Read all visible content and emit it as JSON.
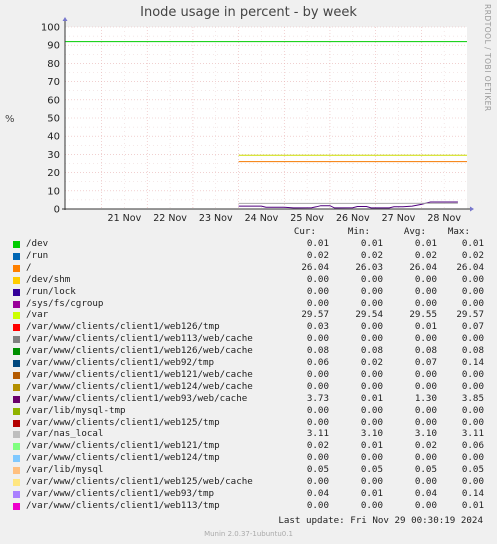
{
  "title": "Inode usage in percent - by week",
  "side_text": "RRDTOOL / TOBI OETIKER",
  "chart_data": {
    "type": "line",
    "ylabel": "%",
    "ylim": [
      0,
      100
    ],
    "y_ticks": [
      0,
      10,
      20,
      30,
      40,
      50,
      60,
      70,
      80,
      90,
      100
    ],
    "x_ticks": [
      "21 Nov",
      "22 Nov",
      "23 Nov",
      "24 Nov",
      "25 Nov",
      "26 Nov",
      "27 Nov",
      "28 Nov"
    ],
    "x_range_days": [
      20.2,
      29.0
    ],
    "series": [
      {
        "name": "/dev",
        "color": "#00cc00",
        "points": [
          [
            20.2,
            92
          ],
          [
            29.0,
            92
          ]
        ]
      },
      {
        "name": "/",
        "color": "#f57900",
        "points": [
          [
            24.0,
            26.04
          ],
          [
            29.0,
            26.04
          ]
        ]
      },
      {
        "name": "/var",
        "color": "#ccdd00",
        "points": [
          [
            24.0,
            29.55
          ],
          [
            29.0,
            29.55
          ]
        ]
      },
      {
        "name": "/var/www/clients/client1/web93/web/cache",
        "color": "#4f007f",
        "points": [
          [
            24.0,
            1.6
          ],
          [
            24.5,
            1.6
          ],
          [
            24.6,
            1.0
          ],
          [
            25.0,
            1.0
          ],
          [
            25.2,
            0.6
          ],
          [
            25.6,
            0.7
          ],
          [
            25.7,
            1.2
          ],
          [
            25.8,
            1.8
          ],
          [
            26.0,
            1.8
          ],
          [
            26.1,
            0.6
          ],
          [
            26.5,
            0.7
          ],
          [
            26.6,
            1.4
          ],
          [
            26.8,
            1.4
          ],
          [
            26.9,
            0.6
          ],
          [
            27.3,
            0.6
          ],
          [
            27.4,
            1.2
          ],
          [
            27.6,
            1.2
          ],
          [
            27.8,
            1.6
          ],
          [
            28.0,
            2.5
          ],
          [
            28.2,
            3.85
          ],
          [
            28.8,
            3.85
          ]
        ]
      },
      {
        "name": "/var/nas_local",
        "color": "#aaaaaa",
        "points": [
          [
            24.0,
            3.1
          ],
          [
            28.8,
            3.11
          ]
        ]
      }
    ]
  },
  "legend_header": {
    "cur": "Cur:",
    "min": "Min:",
    "avg": "Avg:",
    "max": "Max:"
  },
  "legend": [
    {
      "color": "#00cc00",
      "name": "/dev",
      "cur": "0.01",
      "min": "0.01",
      "avg": "0.01",
      "max": "0.01"
    },
    {
      "color": "#0066b3",
      "name": "/run",
      "cur": "0.02",
      "min": "0.02",
      "avg": "0.02",
      "max": "0.02"
    },
    {
      "color": "#ff8000",
      "name": "/",
      "cur": "26.04",
      "min": "26.03",
      "avg": "26.04",
      "max": "26.04"
    },
    {
      "color": "#ffcc00",
      "name": "/dev/shm",
      "cur": "0.00",
      "min": "0.00",
      "avg": "0.00",
      "max": "0.00"
    },
    {
      "color": "#330099",
      "name": "/run/lock",
      "cur": "0.00",
      "min": "0.00",
      "avg": "0.00",
      "max": "0.00"
    },
    {
      "color": "#990099",
      "name": "/sys/fs/cgroup",
      "cur": "0.00",
      "min": "0.00",
      "avg": "0.00",
      "max": "0.00"
    },
    {
      "color": "#ccff00",
      "name": "/var",
      "cur": "29.57",
      "min": "29.54",
      "avg": "29.55",
      "max": "29.57"
    },
    {
      "color": "#ff0000",
      "name": "/var/www/clients/client1/web126/tmp",
      "cur": "0.03",
      "min": "0.00",
      "avg": "0.01",
      "max": "0.07"
    },
    {
      "color": "#808080",
      "name": "/var/www/clients/client1/web113/web/cache",
      "cur": "0.00",
      "min": "0.00",
      "avg": "0.00",
      "max": "0.00"
    },
    {
      "color": "#008f00",
      "name": "/var/www/clients/client1/web126/web/cache",
      "cur": "0.08",
      "min": "0.08",
      "avg": "0.08",
      "max": "0.08"
    },
    {
      "color": "#00487d",
      "name": "/var/www/clients/client1/web92/tmp",
      "cur": "0.06",
      "min": "0.02",
      "avg": "0.07",
      "max": "0.14"
    },
    {
      "color": "#b35a00",
      "name": "/var/www/clients/client1/web121/web/cache",
      "cur": "0.00",
      "min": "0.00",
      "avg": "0.00",
      "max": "0.00"
    },
    {
      "color": "#b38f00",
      "name": "/var/www/clients/client1/web124/web/cache",
      "cur": "0.00",
      "min": "0.00",
      "avg": "0.00",
      "max": "0.00"
    },
    {
      "color": "#6b006b",
      "name": "/var/www/clients/client1/web93/web/cache",
      "cur": "3.73",
      "min": "0.01",
      "avg": "1.30",
      "max": "3.85"
    },
    {
      "color": "#8fb300",
      "name": "/var/lib/mysql-tmp",
      "cur": "0.00",
      "min": "0.00",
      "avg": "0.00",
      "max": "0.00"
    },
    {
      "color": "#b30000",
      "name": "/var/www/clients/client1/web125/tmp",
      "cur": "0.00",
      "min": "0.00",
      "avg": "0.00",
      "max": "0.00"
    },
    {
      "color": "#bebebe",
      "name": "/var/nas_local",
      "cur": "3.11",
      "min": "3.10",
      "avg": "3.10",
      "max": "3.11"
    },
    {
      "color": "#80ff80",
      "name": "/var/www/clients/client1/web121/tmp",
      "cur": "0.02",
      "min": "0.01",
      "avg": "0.02",
      "max": "0.06"
    },
    {
      "color": "#80c9ff",
      "name": "/var/www/clients/client1/web124/tmp",
      "cur": "0.00",
      "min": "0.00",
      "avg": "0.00",
      "max": "0.00"
    },
    {
      "color": "#ffc080",
      "name": "/var/lib/mysql",
      "cur": "0.05",
      "min": "0.05",
      "avg": "0.05",
      "max": "0.05"
    },
    {
      "color": "#ffe680",
      "name": "/var/www/clients/client1/web125/web/cache",
      "cur": "0.00",
      "min": "0.00",
      "avg": "0.00",
      "max": "0.00"
    },
    {
      "color": "#aa80ff",
      "name": "/var/www/clients/client1/web93/tmp",
      "cur": "0.04",
      "min": "0.01",
      "avg": "0.04",
      "max": "0.14"
    },
    {
      "color": "#ee00cc",
      "name": "/var/www/clients/client1/web113/tmp",
      "cur": "0.00",
      "min": "0.00",
      "avg": "0.00",
      "max": "0.01"
    }
  ],
  "last_update": "Last update: Fri Nov 29 00:30:19 2024",
  "munin_version": "Munin 2.0.37-1ubuntu0.1"
}
